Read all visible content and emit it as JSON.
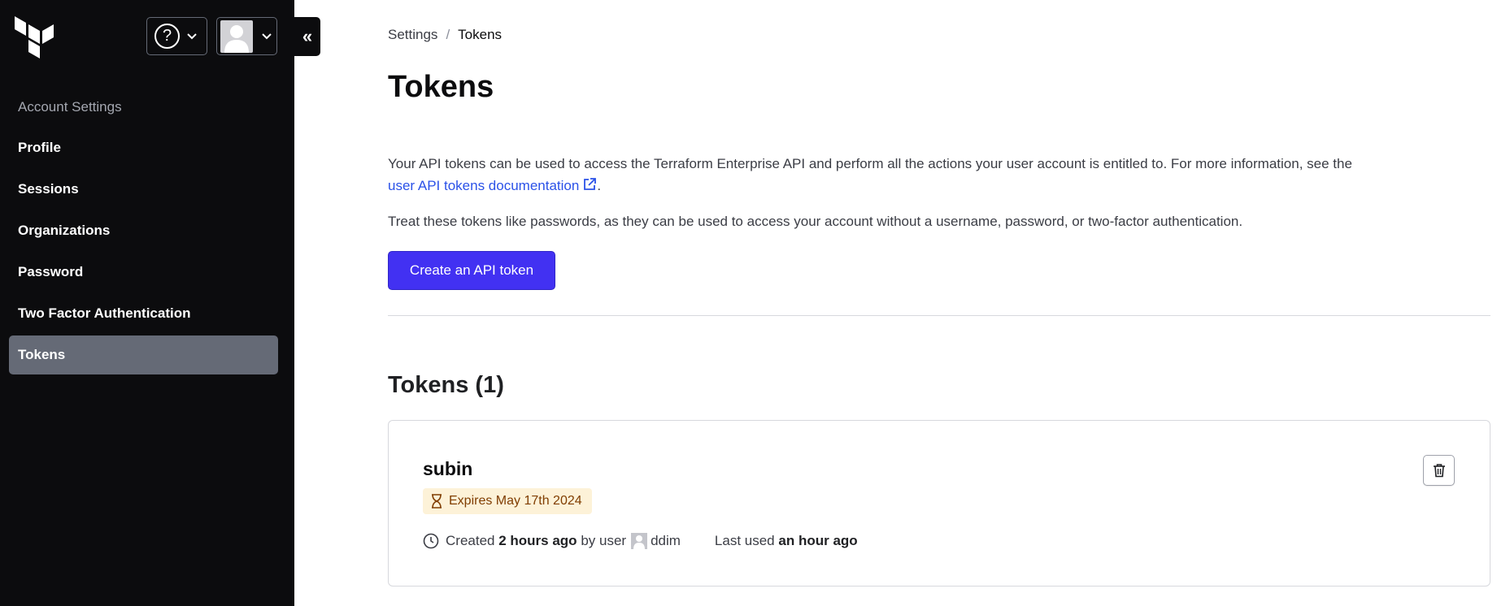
{
  "header": {
    "help_glyph": "?",
    "collapse_glyph": "«",
    "logo_icon": "terraform-logo-icon",
    "help_icon": "help-circle-icon",
    "user_icon": "user-avatar-icon"
  },
  "sidebar": {
    "section_label": "Account Settings",
    "items": [
      {
        "label": "Profile",
        "active": false
      },
      {
        "label": "Sessions",
        "active": false
      },
      {
        "label": "Organizations",
        "active": false
      },
      {
        "label": "Password",
        "active": false
      },
      {
        "label": "Two Factor Authentication",
        "active": false
      },
      {
        "label": "Tokens",
        "active": true
      }
    ]
  },
  "breadcrumb": {
    "parent": "Settings",
    "separator": "/",
    "current": "Tokens"
  },
  "page": {
    "title": "Tokens",
    "description_text": "Your API tokens can be used to access the Terraform Enterprise API and perform all the actions your user account is entitled to. For more information, see the",
    "description_link": "user API tokens documentation",
    "description_end": ".",
    "warning_text": "Treat these tokens like passwords, as they can be used to access your account without a username, password, or two-factor authentication.",
    "create_button": "Create an API token",
    "section_title": "Tokens (1)"
  },
  "tokens": [
    {
      "name": "subin",
      "expires": "Expires May 17th 2024",
      "created_prefix": "Created",
      "created_when": "2 hours ago",
      "by_label": "by user",
      "user": "ddim",
      "last_used_label": "Last used",
      "last_used": "an hour ago"
    }
  ],
  "colors": {
    "sidebar_bg": "#0c0c0e",
    "active_nav": "#656a76",
    "primary_button": "#4231f2",
    "link": "#2b52e8",
    "expires_bg": "#fdf2d8",
    "expires_text": "#803d00"
  }
}
